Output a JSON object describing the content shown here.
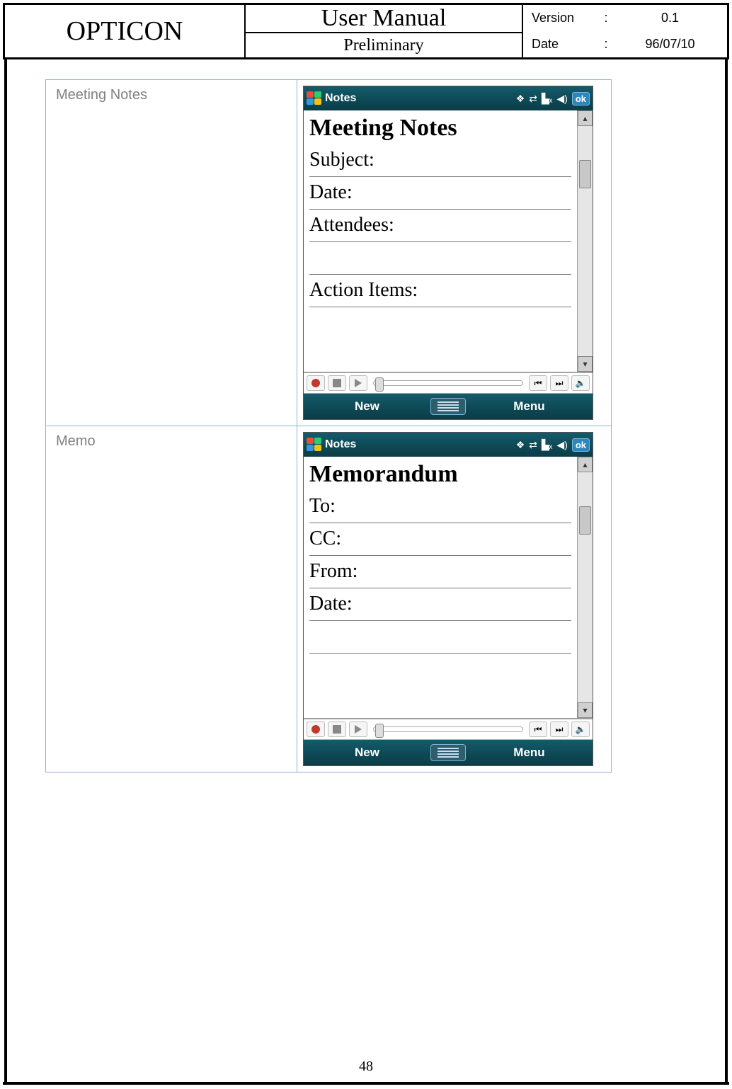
{
  "header": {
    "brand": "OPTICON",
    "title": "User Manual",
    "subtitle": "Preliminary",
    "version_label": "Version",
    "version_value": "0.1",
    "date_label": "Date",
    "date_value": "96/07/10",
    "sep": ":"
  },
  "rows": [
    {
      "label": "Meeting Notes",
      "app_title": "Notes",
      "ok": "ok",
      "heading": "Meeting Notes",
      "lines": [
        "Subject:",
        "Date:",
        "Attendees:",
        "",
        "Action Items:",
        ""
      ],
      "soft_left": "New",
      "soft_right": "Menu"
    },
    {
      "label": "Memo",
      "app_title": "Notes",
      "ok": "ok",
      "heading": "Memorandum",
      "lines": [
        "To:",
        "CC:",
        "From:",
        "Date:",
        "",
        ""
      ],
      "soft_left": "New",
      "soft_right": "Menu"
    }
  ],
  "page_number": "48"
}
